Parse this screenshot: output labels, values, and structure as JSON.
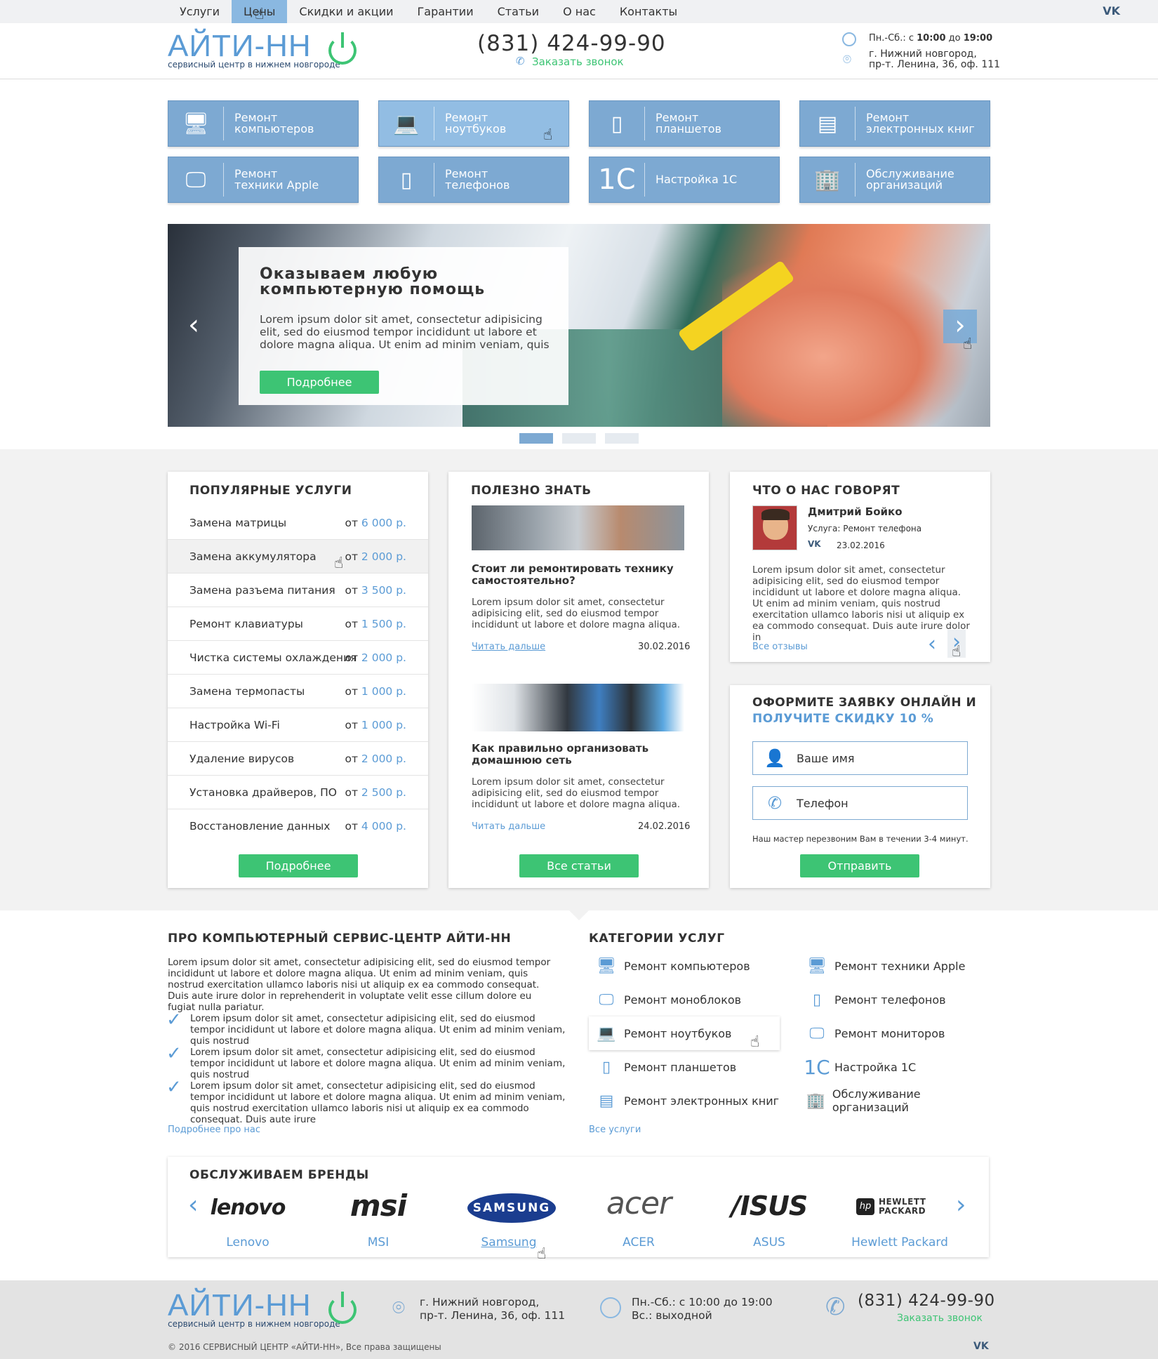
{
  "nav": {
    "items": [
      "Услуги",
      "Цены",
      "Скидки и акции",
      "Гарантии",
      "Статьи",
      "О нас",
      "Контакты"
    ],
    "active": "Цены",
    "social": "VK"
  },
  "header": {
    "logo_text": "АЙТИ-НН",
    "logo_subtitle": "сервисный центр в нижнем новгороде",
    "phone": "(831) 424-99-90",
    "callback": "Заказать звонок",
    "hours_prefix": "Пн.-Сб.: с ",
    "hours_from": "10:00",
    "hours_mid": " до ",
    "hours_to": "19:00",
    "address_line1": "г. Нижний новгород,",
    "address_line2": "пр-т. Ленина, 36, оф. 111"
  },
  "services": [
    {
      "line1": "Ремонт",
      "line2": "компьютеров",
      "icon": "desktop-icon"
    },
    {
      "line1": "Ремонт",
      "line2": "ноутбуков",
      "icon": "laptop-icon"
    },
    {
      "line1": "Ремонт",
      "line2": "планшетов",
      "icon": "tablet-icon"
    },
    {
      "line1": "Ремонт",
      "line2": "электронных книг",
      "icon": "ebook-icon"
    },
    {
      "line1": "Ремонт",
      "line2": "техники Apple",
      "icon": "apple-monitor-icon"
    },
    {
      "line1": "Ремонт",
      "line2": "телефонов",
      "icon": "phone-icon"
    },
    {
      "line1": "Настройка 1С",
      "line2": "",
      "icon": "1c-icon",
      "glyph": "1С"
    },
    {
      "line1": "Обслуживание",
      "line2": "организаций",
      "icon": "building-icon"
    }
  ],
  "slider": {
    "title_line1": "Оказываем любую",
    "title_line2": "компьютерную помощь",
    "text": "Lorem ipsum dolor sit amet, consectetur adipisicing elit, sed do eiusmod tempor incididunt ut labore et dolore magna aliqua. Ut enim ad minim veniam, quis",
    "button": "Подробнее",
    "prev": "‹",
    "next": "›"
  },
  "popular": {
    "title": "ПОПУЛЯРНЫЕ УСЛУГИ",
    "price_prefix": "от ",
    "rows": [
      {
        "name": "Замена матрицы",
        "price": "6 000 р."
      },
      {
        "name": "Замена аккумулятора",
        "price": "2 000 р."
      },
      {
        "name": "Замена разъема питания",
        "price": "3 500 р."
      },
      {
        "name": "Ремонт клавиатуры",
        "price": "1 500 р."
      },
      {
        "name": "Чистка системы охлаждения",
        "price": "2 000 р."
      },
      {
        "name": "Замена термопасты",
        "price": "1 000 р."
      },
      {
        "name": "Настройка Wi-Fi",
        "price": "1 000 р."
      },
      {
        "name": "Удаление вирусов",
        "price": "2 000 р."
      },
      {
        "name": "Установка драйверов, ПО",
        "price": "2 500 р."
      },
      {
        "name": "Восстановление данных",
        "price": "4 000 р."
      }
    ],
    "button": "Подробнее"
  },
  "useful": {
    "title": "ПОЛЕЗНО ЗНАТЬ",
    "articles": [
      {
        "title_line1": "Стоит ли ремонтировать технику",
        "title_line2": "самостоятельно?",
        "text": "Lorem ipsum dolor sit amet, consectetur adipisicing elit, sed do eiusmod tempor incididunt ut labore et dolore magna aliqua.",
        "link": "Читать дальше",
        "date": "30.02.2016"
      },
      {
        "title_line1": "Как правильно организовать",
        "title_line2": "домашнюю сеть",
        "text": "Lorem ipsum dolor sit amet, consectetur adipisicing elit, sed do eiusmod tempor incididunt ut labore et dolore magna aliqua.",
        "link": "Читать дальше",
        "date": "24.02.2016"
      }
    ],
    "button": "Все статьи"
  },
  "reviews": {
    "title": "ЧТО О НАС ГОВОРЯТ",
    "name": "Дмитрий Бойко",
    "service_label": "Услуга:",
    "service": "Ремонт телефона",
    "date": "23.02.2016",
    "text": "Lorem ipsum dolor sit amet, consectetur adipisicing elit, sed do eiusmod tempor incididunt ut labore et dolore magna aliqua. Ut enim ad minim veniam, quis nostrud exercitation ullamco laboris nisi ut aliquip ex ea commodo consequat. Duis aute irure dolor in",
    "all_link": "Все отзывы"
  },
  "order": {
    "title_line1": "ОФОРМИТЕ ЗАЯВКУ ОНЛАЙН И",
    "title_line2": "ПОЛУЧИТЕ СКИДКУ 10 %",
    "name_placeholder": "Ваше имя",
    "phone_placeholder": "Телефон",
    "note": "Наш мастер перезвоним Вам в течении 3-4 минут.",
    "button": "Отправить"
  },
  "about": {
    "title": "ПРО КОМПЬЮТЕРНЫЙ СЕРВИС-ЦЕНТР АЙТИ-НН",
    "intro": "Lorem ipsum dolor sit amet, consectetur adipisicing elit, sed do eiusmod tempor incididunt ut labore et dolore magna aliqua. Ut enim ad minim veniam, quis nostrud exercitation ullamco laboris nisi ut aliquip ex ea commodo consequat. Duis aute irure dolor in reprehenderit in voluptate velit esse cillum dolore eu fugiat nulla pariatur.",
    "points": [
      "Lorem ipsum dolor sit amet, consectetur adipisicing elit, sed do eiusmod tempor incididunt ut labore et dolore magna aliqua. Ut enim ad minim veniam, quis nostrud",
      "Lorem ipsum dolor sit amet, consectetur adipisicing elit, sed do eiusmod tempor incididunt ut labore et dolore magna aliqua. Ut enim ad minim veniam, quis nostrud",
      "Lorem ipsum dolor sit amet, consectetur adipisicing elit, sed do eiusmod tempor incididunt ut labore et dolore magna aliqua. Ut enim ad minim veniam, quis nostrud exercitation ullamco laboris nisi ut aliquip ex ea commodo consequat. Duis aute irure"
    ],
    "link": "Подробнее про нас"
  },
  "categories": {
    "title": "КАТЕГОРИИ УСЛУГ",
    "left": [
      {
        "label": "Ремонт компьютеров",
        "icon": "desktop-icon"
      },
      {
        "label": "Ремонт моноблоков",
        "icon": "monoblock-icon"
      },
      {
        "label": "Ремонт ноутбуков",
        "icon": "laptop-icon"
      },
      {
        "label": "Ремонт планшетов",
        "icon": "tablet-icon"
      },
      {
        "label": "Ремонт электронных книг",
        "icon": "ebook-icon"
      }
    ],
    "right": [
      {
        "label": "Ремонт техники Apple",
        "icon": "apple-monitor-icon"
      },
      {
        "label": "Ремонт телефонов",
        "icon": "phone-icon"
      },
      {
        "label": "Ремонт мониторов",
        "icon": "monitor-icon"
      },
      {
        "label": "Настройка 1С",
        "icon": "1c-icon"
      },
      {
        "label": "Обслуживание организаций",
        "icon": "building-icon"
      }
    ],
    "all_link": "Все услуги"
  },
  "brands": {
    "title": "ОБСЛУЖИВАЕМ БРЕНДЫ",
    "items": [
      {
        "logo": "lenovo",
        "name": "Lenovo"
      },
      {
        "logo": "msi",
        "name": "MSI"
      },
      {
        "logo": "SAMSUNG",
        "name": "Samsung"
      },
      {
        "logo": "acer",
        "name": "ACER"
      },
      {
        "logo": "/ISUS",
        "name": "ASUS"
      },
      {
        "logo": "HEWLETT PACKARD",
        "name": "Hewlett Packard"
      }
    ],
    "prev": "‹",
    "next": "›"
  },
  "footer": {
    "logo_text": "АЙТИ-НН",
    "logo_subtitle": "сервисный центр в нижнем новгороде",
    "address_line1": "г. Нижний новгород,",
    "address_line2": "пр-т. Ленина, 36, оф. 111",
    "hours_line1": "Пн.-Сб.: с 10:00 до 19:00",
    "hours_line2": "Вс.: выходной",
    "phone": "(831) 424-99-90",
    "callback": "Заказать звонок",
    "copyright": "© 2016 СЕРВИСНЫЙ ЦЕНТР «АЙТИ-НН», Все права защищены",
    "social": "VK"
  },
  "colors": {
    "accent_blue": "#7da9d2",
    "link_blue": "#5b9bd5",
    "green": "#3dc474"
  }
}
